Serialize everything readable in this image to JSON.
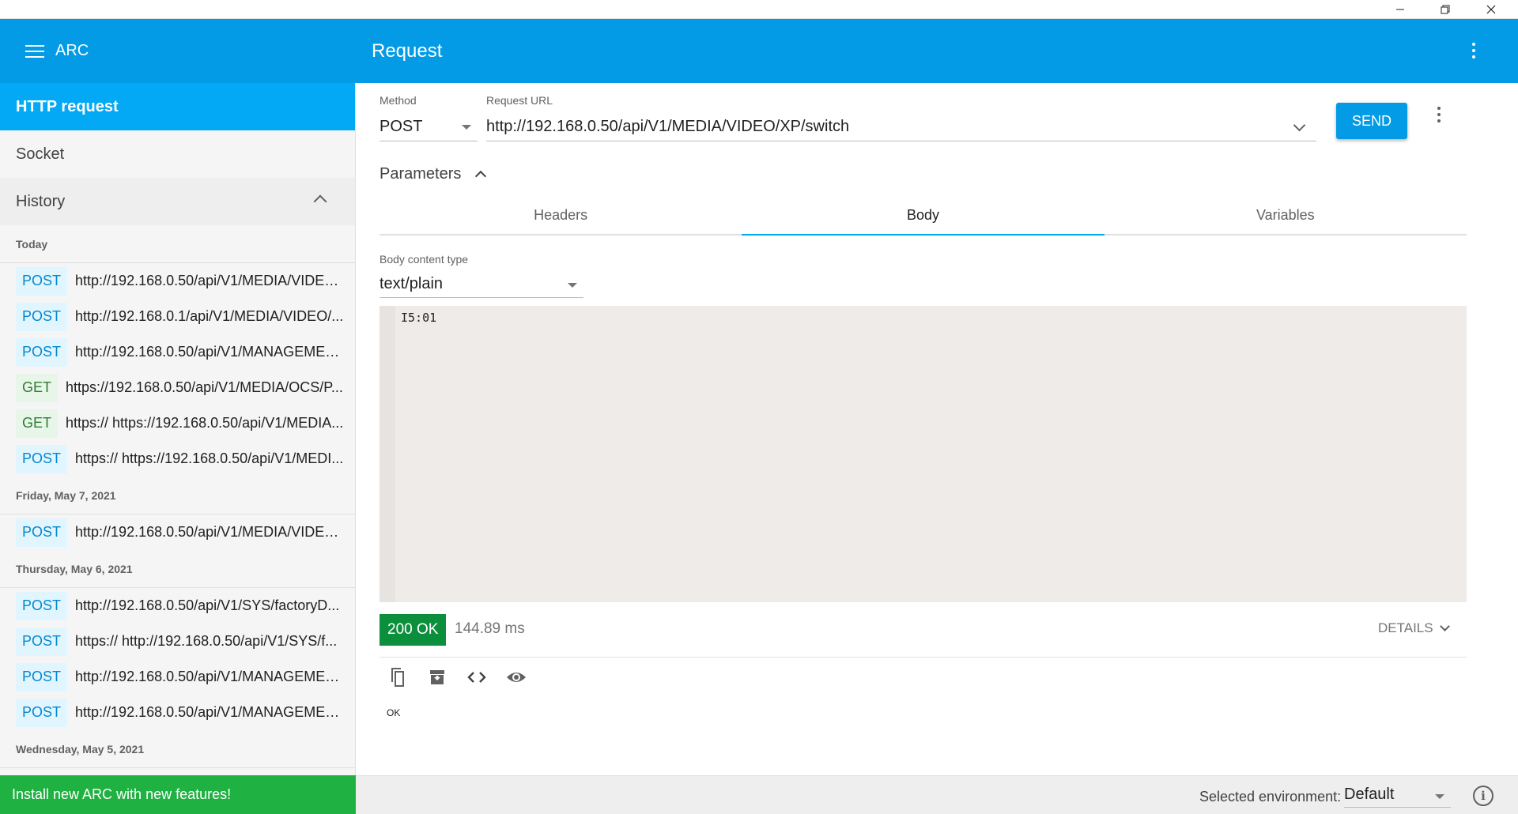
{
  "app": {
    "title": "ARC"
  },
  "page": {
    "title": "Request"
  },
  "sidebar": {
    "nav": {
      "http_request": "HTTP request",
      "socket": "Socket",
      "history": "History"
    },
    "groups": [
      {
        "label": "Today",
        "items": [
          {
            "method": "POST",
            "url": "http://192.168.0.50/api/V1/MEDIA/VIDEO..."
          },
          {
            "method": "POST",
            "url": "http://192.168.0.1/api/V1/MEDIA/VIDEO/..."
          },
          {
            "method": "POST",
            "url": "http://192.168.0.50/api/V1/MANAGEMEN..."
          },
          {
            "method": "GET",
            "url": "https://192.168.0.50/api/V1/MEDIA/OCS/P..."
          },
          {
            "method": "GET",
            "url": "https:// https://192.168.0.50/api/V1/MEDIA..."
          },
          {
            "method": "POST",
            "url": "https:// https://192.168.0.50/api/V1/MEDI..."
          }
        ]
      },
      {
        "label": "Friday, May 7, 2021",
        "items": [
          {
            "method": "POST",
            "url": "http://192.168.0.50/api/V1/MEDIA/VIDEO..."
          }
        ]
      },
      {
        "label": "Thursday, May 6, 2021",
        "items": [
          {
            "method": "POST",
            "url": "http://192.168.0.50/api/V1/SYS/factoryD..."
          },
          {
            "method": "POST",
            "url": "https:// http://192.168.0.50/api/V1/SYS/f..."
          },
          {
            "method": "POST",
            "url": "http://192.168.0.50/api/V1/MANAGEMEN..."
          },
          {
            "method": "POST",
            "url": "http://192.168.0.50/api/V1/MANAGEMEN..."
          }
        ]
      },
      {
        "label": "Wednesday, May 5, 2021",
        "items": []
      }
    ],
    "install_banner": "Install new ARC with new features!"
  },
  "request": {
    "method_label": "Method",
    "method_value": "POST",
    "url_label": "Request URL",
    "url_value": "http://192.168.0.50/api/V1/MEDIA/VIDEO/XP/switch",
    "send_label": "SEND",
    "parameters_label": "Parameters",
    "tabs": [
      "Headers",
      "Body",
      "Variables"
    ],
    "active_tab": "Body",
    "body_type_label": "Body content type",
    "body_type_value": "text/plain",
    "body_text": "I5:01"
  },
  "response": {
    "status": "200 OK",
    "time": "144.89 ms",
    "details_label": "DETAILS",
    "body": "OK"
  },
  "footer": {
    "env_label": "Selected environment:",
    "env_value": "Default"
  },
  "icons": {
    "menu": "hamburger-icon",
    "more": "more-vert-icon",
    "copy": "copy-icon",
    "save": "save-icon",
    "code": "code-icon",
    "preview": "eye-icon",
    "info": "info-icon"
  },
  "colors": {
    "primary": "#039be5",
    "active_nav": "#03a9f4",
    "post_badge_bg": "#e1f5fe",
    "post_badge_text": "#0288d1",
    "get_badge_bg": "#e8f5e9",
    "get_badge_text": "#2e7d32",
    "status_ok": "#0b8f3c",
    "install_banner": "#1fb141",
    "editor_bg": "#efebe9"
  }
}
